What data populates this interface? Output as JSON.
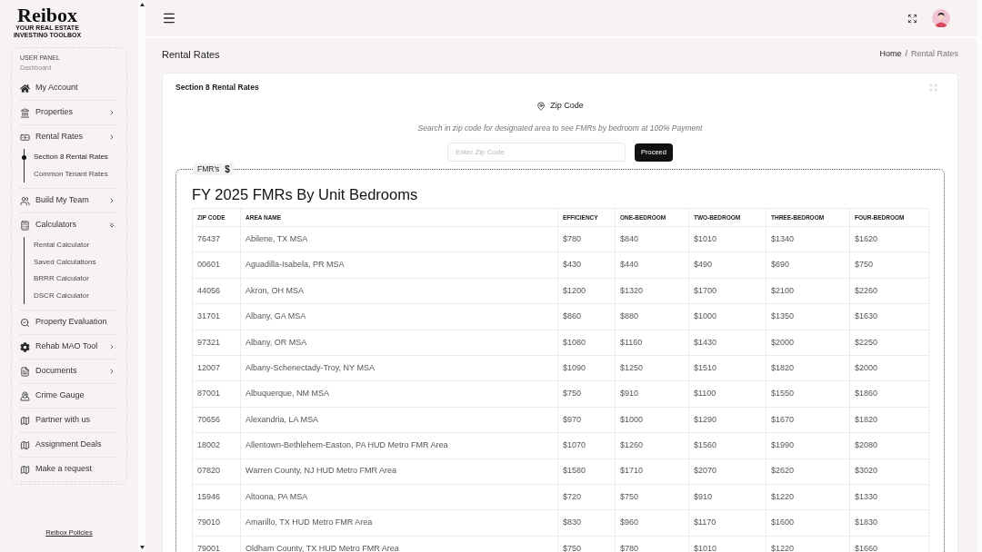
{
  "sidebar": {
    "logo": {
      "name": "Reibox",
      "tagline_lines": [
        "YOUR REAL ESTATE",
        "INVESTING TOOLBOX"
      ]
    },
    "panel": {
      "title": "USER PANEL",
      "subtitle": "Dashboard"
    },
    "items": [
      {
        "label": "My Account"
      },
      {
        "label": "Properties",
        "expanded": false
      },
      {
        "label": "Rental Rates",
        "expanded": false,
        "children": [
          {
            "label": "Section 8 Rental Rates",
            "selected": true
          },
          {
            "label": "Common Tenant Rates",
            "selected": false
          }
        ]
      },
      {
        "label": "Build My Team",
        "expanded": false
      },
      {
        "label": "Calculators",
        "expanded": true,
        "children": [
          {
            "label": "Rental Calculator",
            "selected": false
          },
          {
            "label": "Saved Calculations",
            "selected": false
          },
          {
            "label": "BRRR Calculator",
            "selected": false
          },
          {
            "label": "DSCR Calculator",
            "selected": false
          }
        ]
      },
      {
        "label": "Property Evaluation"
      },
      {
        "label": "Rehab MAO Tool",
        "expanded": false
      },
      {
        "label": "Documents",
        "expanded": false
      },
      {
        "label": "Crime Gauge"
      },
      {
        "label": "Partner with us"
      },
      {
        "label": "Assignment Deals"
      },
      {
        "label": "Make a request"
      }
    ],
    "footer_link": "Reibox Policies"
  },
  "page": {
    "title": "Rental Rates",
    "breadcrumb": {
      "items": [
        "Home",
        "Rental Rates"
      ],
      "separator": "/"
    }
  },
  "card": {
    "title": "Section 8 Rental Rates",
    "search": {
      "label": "Zip Code",
      "hint": "Search in zip code for designated area to see FMRs by bedroom at 100% Payment",
      "placeholder": "Enter Zip Code",
      "button": "Proceed"
    },
    "fmr": {
      "legend": "FMR's",
      "legend_symbol": "$",
      "heading": "FY 2025 FMRs By Unit Bedrooms",
      "table": {
        "columns": [
          "ZIP CODE",
          "AREA NAME",
          "EFFICIENCY",
          "ONE-BEDROOM",
          "TWO-BEDROOM",
          "THREE-BEDROOM",
          "FOUR-BEDROOM"
        ],
        "rows": [
          [
            "76437",
            "Abilene, TX MSA",
            "$780",
            "$840",
            "$1010",
            "$1340",
            "$1620"
          ],
          [
            "00601",
            "Aguadilla-Isabela, PR MSA",
            "$430",
            "$440",
            "$490",
            "$690",
            "$750"
          ],
          [
            "44056",
            "Akron, OH MSA",
            "$1200",
            "$1320",
            "$1700",
            "$2100",
            "$2260"
          ],
          [
            "31701",
            "Albany, GA MSA",
            "$860",
            "$880",
            "$1000",
            "$1350",
            "$1630"
          ],
          [
            "97321",
            "Albany, OR MSA",
            "$1080",
            "$1160",
            "$1430",
            "$2000",
            "$2250"
          ],
          [
            "12007",
            "Albany-Schenectady-Troy, NY MSA",
            "$1090",
            "$1250",
            "$1510",
            "$1820",
            "$2000"
          ],
          [
            "87001",
            "Albuquerque, NM MSA",
            "$750",
            "$910",
            "$1100",
            "$1550",
            "$1860"
          ],
          [
            "70656",
            "Alexandria, LA MSA",
            "$970",
            "$1000",
            "$1290",
            "$1670",
            "$1820"
          ],
          [
            "18002",
            "Allentown-Bethlehem-Easton, PA HUD Metro FMR Area",
            "$1070",
            "$1260",
            "$1560",
            "$1990",
            "$2080"
          ],
          [
            "07820",
            "Warren County, NJ HUD Metro FMR Area",
            "$1580",
            "$1710",
            "$2070",
            "$2620",
            "$3020"
          ],
          [
            "15946",
            "Altoona, PA MSA",
            "$720",
            "$750",
            "$910",
            "$1220",
            "$1330"
          ],
          [
            "79010",
            "Amarillo, TX HUD Metro FMR Area",
            "$830",
            "$960",
            "$1170",
            "$1600",
            "$1830"
          ],
          [
            "79001",
            "Oldham County, TX HUD Metro FMR Area",
            "$750",
            "$780",
            "$1010",
            "$1220",
            "$1660"
          ]
        ]
      }
    }
  }
}
